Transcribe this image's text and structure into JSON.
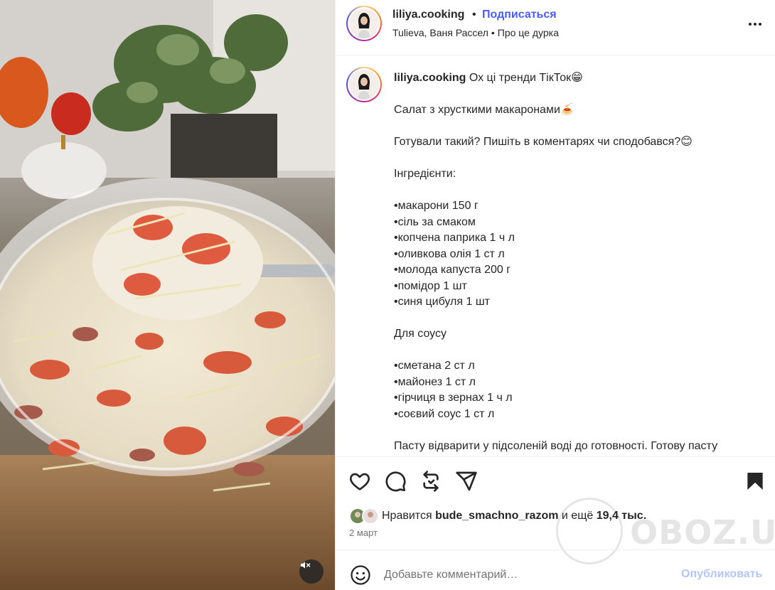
{
  "header": {
    "username": "liliya.cooking",
    "separator": "•",
    "follow_label": "Подписаться",
    "sub_left": "Tulieva, Ваня Рассел",
    "sub_sep": "•",
    "sub_right": "Про це дурка",
    "more_icon": "more-horizontal-icon"
  },
  "caption": {
    "username": "liliya.cooking",
    "lines": [
      "Ох ці тренди ТікТок😁",
      "",
      "Салат з хрусткими макаронами🍝",
      "",
      "Готували такий? Пишіть в коментарях чи сподобався?😊",
      "",
      "Інгредієнти:",
      "",
      "•макарони 150 г",
      "•сіль за смаком",
      "•копчена паприка 1 ч л",
      "•оливкова олія 1 ст л",
      "•молода капуста 200 г",
      "•помідор 1 шт",
      "•синя цибуля 1 шт",
      "",
      "Для соусу",
      "",
      "•сметана 2 ст л",
      "•майонез 1 ст л",
      "•гірчиця в зернах 1 ч л",
      "•соєвий соус 1 ст л",
      "",
      "Пасту відварити у підсоленій воді до готовності. Готову пасту"
    ]
  },
  "actions": {
    "icons": [
      "heart-icon",
      "comment-icon",
      "share-icon",
      "send-icon",
      "bookmark-icon"
    ]
  },
  "likes": {
    "prefix": "Нравится",
    "user": "bude_smachno_razom",
    "middle": "и ещё",
    "count": "19,4 тыс."
  },
  "date": "2 март",
  "comment": {
    "placeholder": "Добавьте комментарий…",
    "publish_label": "Опубликовать"
  },
  "watermark": "OBOZ.UA",
  "colors": {
    "accent": "#4a5df9",
    "publish_disabled": "#b2c6fb",
    "text": "#262626",
    "muted": "#737373",
    "border": "#efefef"
  }
}
